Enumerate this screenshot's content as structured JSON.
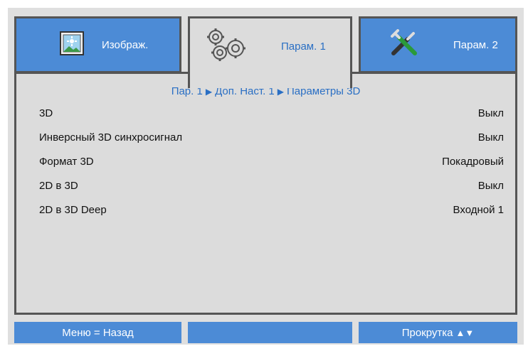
{
  "tabs": [
    {
      "label": "Изображ.",
      "icon": "picture-icon",
      "active": false
    },
    {
      "label": "Парам. 1",
      "icon": "gears-icon",
      "active": true
    },
    {
      "label": "Парам. 2",
      "icon": "tools-icon",
      "active": false
    }
  ],
  "breadcrumb": {
    "part1": "Пар. 1",
    "part2": "Доп. Наст. 1",
    "part3": "Параметры 3D",
    "separator": "▶"
  },
  "rows": [
    {
      "label": "3D",
      "value": "Выкл"
    },
    {
      "label": "Инверсный 3D синхросигнал",
      "value": "Выкл"
    },
    {
      "label": "Формат 3D",
      "value": "Покадровый"
    },
    {
      "label": "2D в 3D",
      "value": "Выкл"
    },
    {
      "label": "2D в 3D Deep",
      "value": "Входной 1"
    }
  ],
  "footer": {
    "left": "Меню = Назад",
    "middle": "",
    "right": "Прокрутка",
    "right_symbols": "▲▼"
  },
  "colors": {
    "tab_blue": "#4c8bd6",
    "active_text": "#2a6fc4",
    "panel_bg": "#dcdcdc",
    "border": "#555555"
  }
}
